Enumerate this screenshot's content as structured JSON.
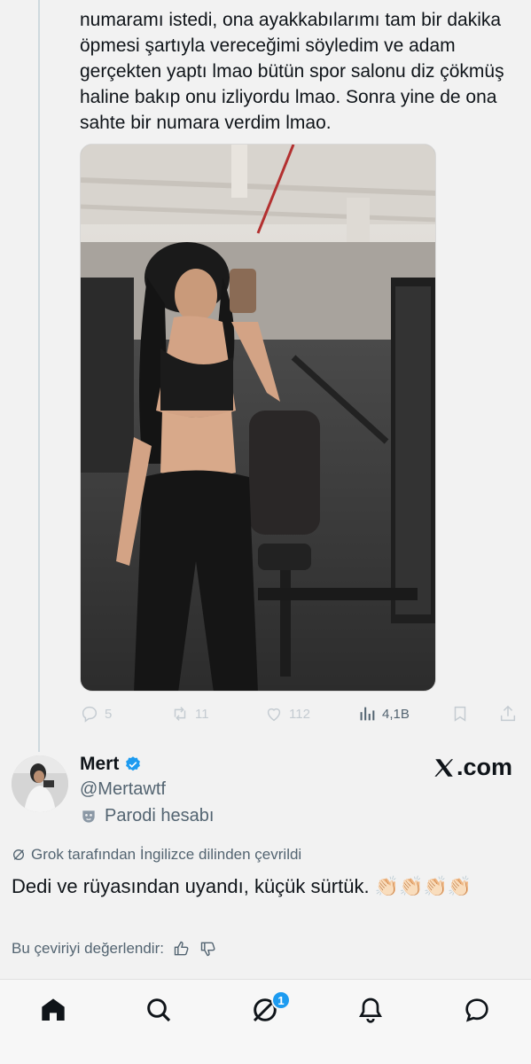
{
  "quoted_tweet": {
    "text": "numaramı istedi, ona ayakkabılarımı tam bir dakika öpmesi şartıyla vereceğimi söyledim ve adam gerçekten yaptı lmao bütün spor salonu diz çökmüş haline bakıp onu izliyordu lmao. Sonra yine de ona sahte bir numara verdim lmao.",
    "actions": {
      "reply_count": "5",
      "retweet_count": "11",
      "like_count": "112",
      "view_count": "4,1B"
    }
  },
  "author": {
    "name": "Mert",
    "handle": "@Mertawtf",
    "parody_label": "Parodi hesabı",
    "verified": true
  },
  "brand": {
    "label": ".com"
  },
  "translation": {
    "notice": "Grok tarafından İngilizce dilinden çevrildi",
    "text": "Dedi ve rüyasından uyandı, küçük sürtük. 👏🏻👏🏻👏🏻👏🏻",
    "rate_label": "Bu çeviriyi değerlendir:"
  },
  "bottom_nav": {
    "items": [
      "home-icon",
      "search-icon",
      "grok-icon",
      "bell-icon",
      "messages-icon"
    ],
    "grok_badge": "1"
  },
  "colors": {
    "accent": "#1d9bf0",
    "text_primary": "#0f1419",
    "text_secondary": "#536471",
    "background": "#f2f2f2"
  }
}
